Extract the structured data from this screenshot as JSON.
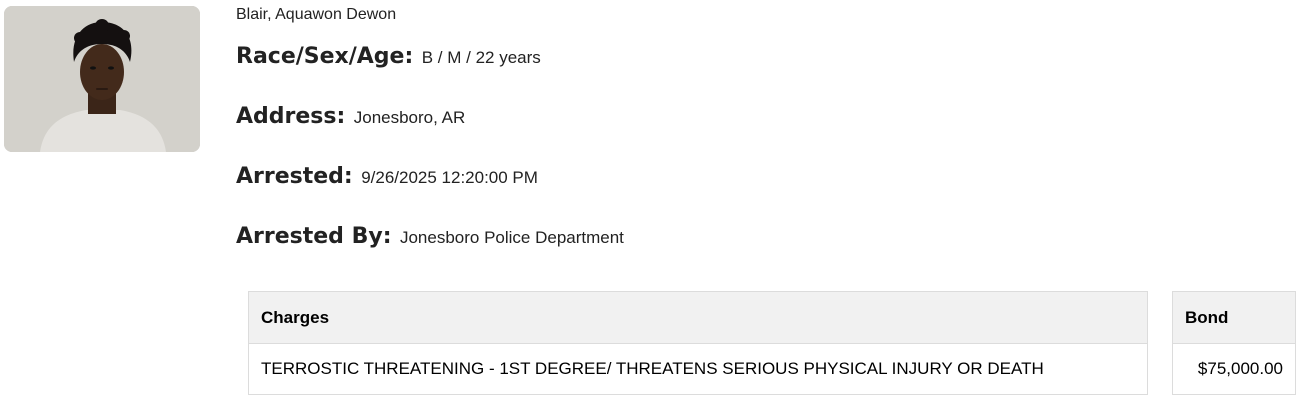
{
  "inmate": {
    "name": "Blair, Aquawon Dewon",
    "photo_alt": "mugshot"
  },
  "fields": {
    "race_sex_age": {
      "label": "Race/Sex/Age:",
      "value": "B / M / 22 years"
    },
    "address": {
      "label": "Address:",
      "value": "Jonesboro, AR"
    },
    "arrested": {
      "label": "Arrested:",
      "value": "9/26/2025 12:20:00 PM"
    },
    "arrested_by": {
      "label": "Arrested By:",
      "value": "Jonesboro Police Department"
    }
  },
  "charges_table": {
    "header": "Charges",
    "rows": [
      "TERROSTIC THREATENING - 1ST DEGREE/ THREATENS SERIOUS PHYSICAL INJURY OR DEATH"
    ]
  },
  "bond_table": {
    "header": "Bond",
    "rows": [
      "$75,000.00"
    ]
  },
  "colors": {
    "table_header_bg": "#f1f1f1",
    "table_border": "#dcdcdc",
    "text": "#222222"
  }
}
